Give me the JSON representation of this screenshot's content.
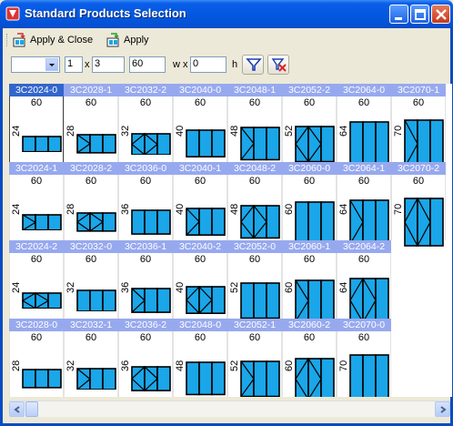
{
  "window": {
    "title": "Standard Products Selection"
  },
  "toolbar": {
    "apply_close_label": "Apply & Close",
    "apply_label": "Apply"
  },
  "filters": {
    "combo_value": "",
    "count_value": "1",
    "x_label": "x",
    "cols_value": "3",
    "width_value": "60",
    "wx_label": "w x",
    "height_value": "0",
    "h_label": "h"
  },
  "colors": {
    "accent": "#3266cc",
    "header": "#97a9ee",
    "glass": "#1aa6e8",
    "titlebar": "#0458e0"
  },
  "grid": {
    "columns": 8,
    "rows": [
      [
        {
          "code": "3C2024-0",
          "w": "60",
          "h": "24",
          "panes": "3",
          "selected": true
        },
        {
          "code": "3C2028-1",
          "w": "60",
          "h": "28",
          "panes": "3x"
        },
        {
          "code": "3C2032-2",
          "w": "60",
          "h": "32",
          "panes": "3x2"
        },
        {
          "code": "3C2040-0",
          "w": "60",
          "h": "40",
          "panes": "3"
        },
        {
          "code": "3C2048-1",
          "w": "60",
          "h": "48",
          "panes": "3x"
        },
        {
          "code": "3C2052-2",
          "w": "60",
          "h": "52",
          "panes": "3x2"
        },
        {
          "code": "3C2064-0",
          "w": "60",
          "h": "64",
          "panes": "3"
        },
        {
          "code": "3C2070-1",
          "w": "60",
          "h": "70",
          "panes": "3x"
        }
      ],
      [
        {
          "code": "3C2024-1",
          "w": "60",
          "h": "24",
          "panes": "3x"
        },
        {
          "code": "3C2028-2",
          "w": "60",
          "h": "28",
          "panes": "3x2"
        },
        {
          "code": "3C2036-0",
          "w": "60",
          "h": "36",
          "panes": "3"
        },
        {
          "code": "3C2040-1",
          "w": "60",
          "h": "40",
          "panes": "3x"
        },
        {
          "code": "3C2048-2",
          "w": "60",
          "h": "48",
          "panes": "3x2"
        },
        {
          "code": "3C2060-0",
          "w": "60",
          "h": "60",
          "panes": "3"
        },
        {
          "code": "3C2064-1",
          "w": "60",
          "h": "64",
          "panes": "3x"
        },
        {
          "code": "3C2070-2",
          "w": "60",
          "h": "70",
          "panes": "3x2"
        }
      ],
      [
        {
          "code": "3C2024-2",
          "w": "60",
          "h": "24",
          "panes": "3x2"
        },
        {
          "code": "3C2032-0",
          "w": "60",
          "h": "32",
          "panes": "3"
        },
        {
          "code": "3C2036-1",
          "w": "60",
          "h": "36",
          "panes": "3x"
        },
        {
          "code": "3C2040-2",
          "w": "60",
          "h": "40",
          "panes": "3x2"
        },
        {
          "code": "3C2052-0",
          "w": "60",
          "h": "52",
          "panes": "3"
        },
        {
          "code": "3C2060-1",
          "w": "60",
          "h": "60",
          "panes": "3x"
        },
        {
          "code": "3C2064-2",
          "w": "60",
          "h": "64",
          "panes": "3x2"
        }
      ],
      [
        {
          "code": "3C2028-0",
          "w": "60",
          "h": "28",
          "panes": "3"
        },
        {
          "code": "3C2032-1",
          "w": "60",
          "h": "32",
          "panes": "3x"
        },
        {
          "code": "3C2036-2",
          "w": "60",
          "h": "36",
          "panes": "3x2"
        },
        {
          "code": "3C2048-0",
          "w": "60",
          "h": "48",
          "panes": "3"
        },
        {
          "code": "3C2052-1",
          "w": "60",
          "h": "52",
          "panes": "3x"
        },
        {
          "code": "3C2060-2",
          "w": "60",
          "h": "60",
          "panes": "3x2"
        },
        {
          "code": "3C2070-0",
          "w": "60",
          "h": "70",
          "panes": "3"
        }
      ]
    ]
  }
}
